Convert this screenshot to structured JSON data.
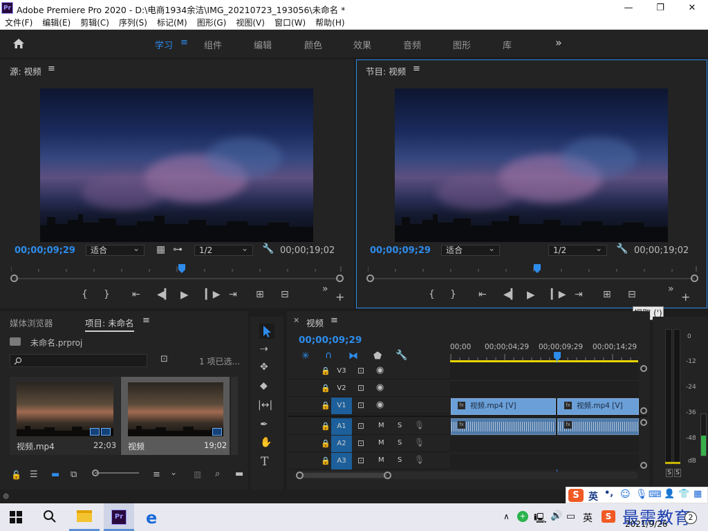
{
  "window": {
    "title": "Adobe Premiere Pro 2020 - D:\\电商1934余洁\\IMG_20210723_193056\\未命名 *",
    "logo": "Pr",
    "minimize_icon": "—",
    "maximize_icon": "❐",
    "close_icon": "✕"
  },
  "menu": [
    "文件(F)",
    "编辑(E)",
    "剪辑(C)",
    "序列(S)",
    "标记(M)",
    "图形(G)",
    "视图(V)",
    "窗口(W)",
    "帮助(H)"
  ],
  "workspaces": {
    "tabs": [
      "学习",
      "组件",
      "编辑",
      "颜色",
      "效果",
      "音频",
      "图形",
      "库"
    ],
    "active": "学习",
    "more": "»"
  },
  "source_monitor": {
    "title": "源: 视频",
    "timecode": "00;00;09;29",
    "fit": "适合",
    "resolution": "1/2",
    "duration": "00;00;19;02",
    "playhead_fraction": 0.52
  },
  "program_monitor": {
    "title": "节目: 视频",
    "timecode": "00;00;09;29",
    "fit": "适合",
    "resolution": "1/2",
    "duration": "00;00;19;02",
    "playhead_fraction": 0.52,
    "tooltip": "提取 (')"
  },
  "project_panel": {
    "tab_media": "媒体浏览器",
    "tab_project": "项目: 未命名",
    "project_file": "未命名.prproj",
    "items_selected": "1 项已选...",
    "items": [
      {
        "name": "视频.mp4",
        "duration": "22;03"
      },
      {
        "name": "视频",
        "duration": "19;02"
      }
    ]
  },
  "timeline": {
    "tab": "视频",
    "timecode": "00;00;09;29",
    "ruler": [
      "00;00",
      "00;00;04;29",
      "00;00;09;29",
      "00;00;14;29"
    ],
    "tracks_video": [
      "V3",
      "V2",
      "V1"
    ],
    "tracks_audio": [
      "A1",
      "A2",
      "A3"
    ],
    "mute": "M",
    "solo": "S",
    "clip1": "视频.mp4 [V]",
    "clip2": "视频.mp4 [V]",
    "fx": "fx"
  },
  "meter": {
    "scale": [
      "0",
      "-12",
      "-24",
      "-36",
      "-48",
      "dB"
    ],
    "solo_left": "S",
    "solo_right": "S"
  },
  "ime": {
    "lang": "英",
    "punct": "•,"
  },
  "taskbar": {
    "date": "2021/9/26",
    "tray_lang": "英",
    "notify_count": "2",
    "watermark": "最需教育"
  },
  "colors": {
    "accent": "#2d8ceb",
    "track_selected": "#1c5f9a",
    "clip_video": "#6a9fd8",
    "clip_audio": "#4f79a8",
    "ruler_yellow": "#e8d400"
  }
}
